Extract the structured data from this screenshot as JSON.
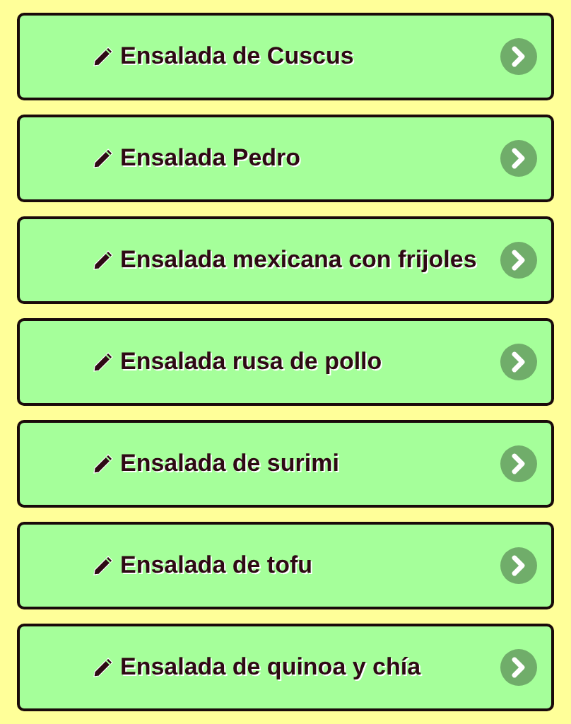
{
  "items": [
    {
      "label": "Ensalada de Cuscus"
    },
    {
      "label": "Ensalada Pedro"
    },
    {
      "label": "Ensalada mexicana con frijoles"
    },
    {
      "label": "Ensalada rusa de pollo"
    },
    {
      "label": "Ensalada de surimi"
    },
    {
      "label": "Ensalada de tofu"
    },
    {
      "label": "Ensalada de quinoa y chía"
    }
  ]
}
